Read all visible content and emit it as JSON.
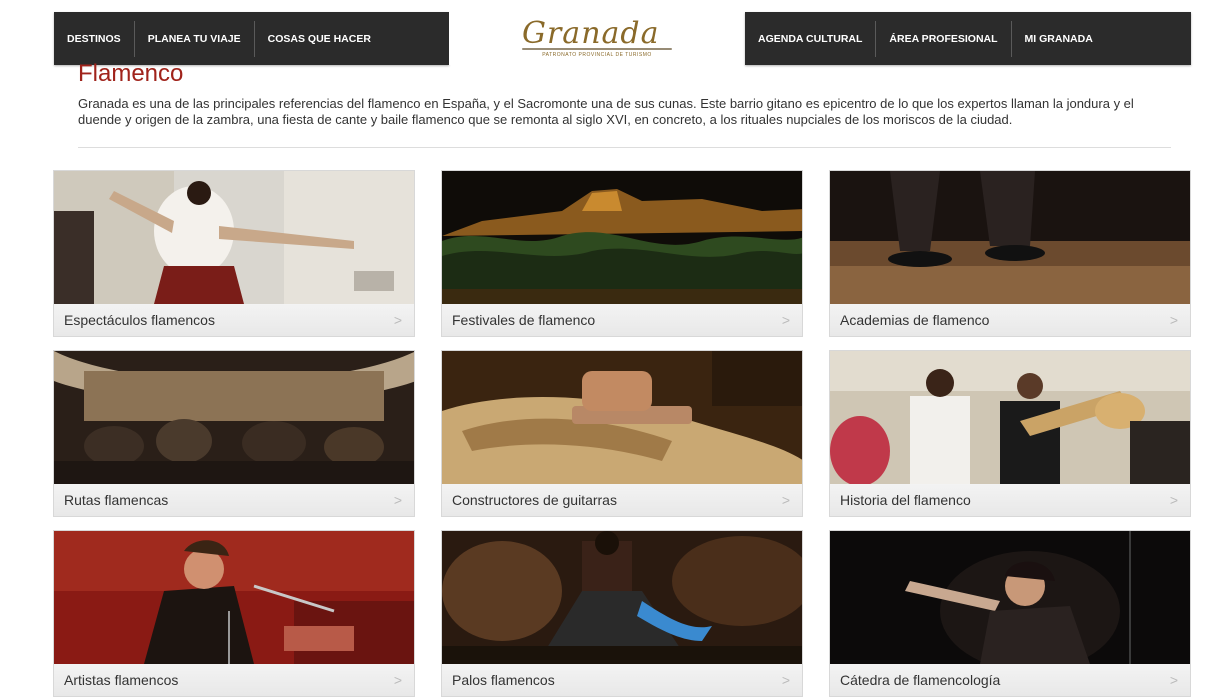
{
  "nav": {
    "left": [
      "DESTINOS",
      "PLANEA TU VIAJE",
      "COSAS QUE HACER"
    ],
    "right": [
      "AGENDA CULTURAL",
      "ÁREA PROFESIONAL",
      "MI GRANADA"
    ],
    "logo_text": "Granada",
    "logo_subtitle": "PATRONATO PROVINCIAL DE TURISMO"
  },
  "page": {
    "title": "Flamenco",
    "intro": "Granada es una de las principales referencias del flamenco en España, y el Sacromonte una de sus cunas. Este barrio gitano es epicentro de lo que los expertos llaman la jondura y el duende y origen de la zambra, una fiesta de cante y baile flamenco que se remonta al siglo XVI, en concreto, a los rituales nupciales de los moriscos de la ciudad."
  },
  "cards": [
    {
      "label": "Espectáculos flamencos",
      "chevron": ">"
    },
    {
      "label": "Festivales de flamenco",
      "chevron": ">"
    },
    {
      "label": "Academias de flamenco",
      "chevron": ">"
    },
    {
      "label": "Rutas flamencas",
      "chevron": ">"
    },
    {
      "label": "Constructores de guitarras",
      "chevron": ">"
    },
    {
      "label": "Historia del flamenco",
      "chevron": ">"
    },
    {
      "label": "Artistas flamencos",
      "chevron": ">"
    },
    {
      "label": "Palos flamencos",
      "chevron": ">"
    },
    {
      "label": "Cátedra de flamencología",
      "chevron": ">"
    }
  ],
  "colors": {
    "nav_bg": "#2b2b2b",
    "title": "#a0231b",
    "logo": "#8a6a2a"
  }
}
